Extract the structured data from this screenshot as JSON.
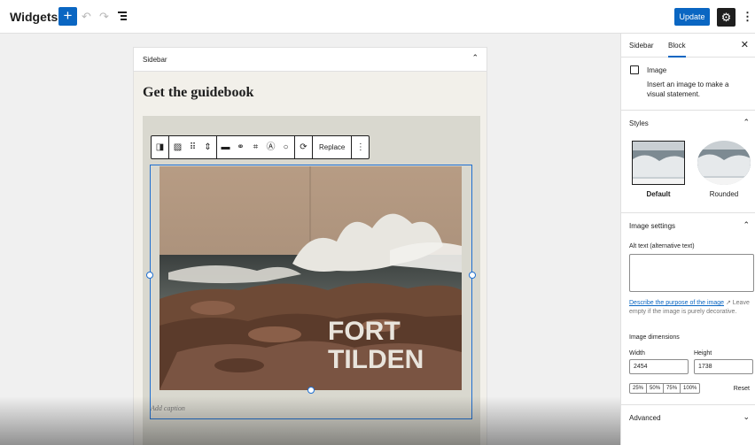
{
  "topbar": {
    "title": "Widgets",
    "add_symbol": "+",
    "undo_symbol": "↶",
    "redo_symbol": "↷",
    "update_label": "Update",
    "settings_symbol": "⚙",
    "more_symbol": "⋮"
  },
  "widget_area": {
    "title": "Sidebar",
    "chevron": "⌃",
    "heading": "Get the guidebook"
  },
  "block_toolbar": {
    "replace_label": "Replace",
    "more_symbol": "⋮"
  },
  "image_block": {
    "image_text_line1": "FORT",
    "image_text_line2": "TILDEN",
    "caption_placeholder": "Add caption"
  },
  "sidebar": {
    "tabs": [
      "Sidebar",
      "Block"
    ],
    "active_tab": "Block",
    "close_symbol": "✕",
    "block_card": {
      "title": "Image",
      "description": "Insert an image to make a visual statement."
    },
    "styles": {
      "title": "Styles",
      "options": [
        "Default",
        "Rounded"
      ],
      "selected": "Default"
    },
    "image_settings": {
      "title": "Image settings",
      "alt_label": "Alt text (alternative text)",
      "alt_value": "",
      "help_link": "Describe the purpose of the image",
      "help_rest": " Leave empty if the image is purely decorative.",
      "dimensions_label": "Image dimensions",
      "width_label": "Width",
      "height_label": "Height",
      "width_value": "2454",
      "height_value": "1738",
      "percent_options": [
        "25%",
        "50%",
        "75%",
        "100%"
      ],
      "reset_label": "Reset"
    },
    "advanced_title": "Advanced"
  },
  "colors": {
    "accent": "#0a66c2",
    "selection": "#1f6fd0"
  }
}
